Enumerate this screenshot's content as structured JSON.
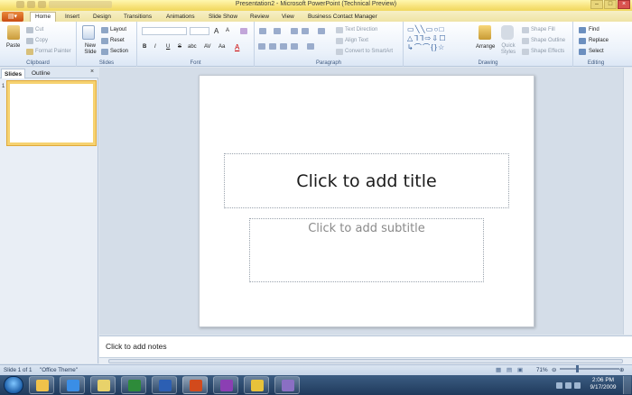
{
  "window": {
    "title": "Presentation2 - Microsoft PowerPoint (Technical Preview)",
    "controls": [
      "–",
      "□",
      "×"
    ]
  },
  "ribbon": {
    "tabs": [
      "Home",
      "Insert",
      "Design",
      "Transitions",
      "Animations",
      "Slide Show",
      "Review",
      "View",
      "Business Contact Manager"
    ],
    "active_tab": "Home",
    "clipboard": {
      "paste": "Paste",
      "cut": "Cut",
      "copy": "Copy",
      "format_painter": "Format Painter",
      "label": "Clipboard"
    },
    "slides": {
      "new_slide": "New Slide",
      "layout": "Layout",
      "reset": "Reset",
      "section": "Section",
      "label": "Slides"
    },
    "font": {
      "bold": "B",
      "italic": "I",
      "underline": "U",
      "strike": "S",
      "shadow": "abc",
      "spacing": "AV",
      "case": "Aa",
      "grow": "A",
      "shrink": "A",
      "color": "A",
      "label": "Font"
    },
    "paragraph": {
      "text_direction": "Text Direction",
      "align_text": "Align Text",
      "smartart": "Convert to SmartArt",
      "label": "Paragraph"
    },
    "drawing": {
      "arrange": "Arrange",
      "quick_styles": "Quick Styles",
      "shape_fill": "Shape Fill",
      "shape_outline": "Shape Outline",
      "shape_effects": "Shape Effects",
      "label": "Drawing"
    },
    "editing": {
      "find": "Find",
      "replace": "Replace",
      "select": "Select",
      "label": "Editing"
    }
  },
  "panel": {
    "tabs": [
      "Slides",
      "Outline"
    ],
    "close": "×",
    "slide_number": "1"
  },
  "slide": {
    "title_placeholder": "Click to add title",
    "subtitle_placeholder": "Click to add subtitle"
  },
  "notes": {
    "placeholder": "Click to add notes"
  },
  "status": {
    "slide_info": "Slide 1 of 1",
    "theme": "\"Office Theme\"",
    "zoom": "71%"
  },
  "taskbar": {
    "time": "2:06 PM",
    "date": "9/17/2009",
    "apps": [
      {
        "name": "folder",
        "color": "#f0c24a"
      },
      {
        "name": "ie",
        "color": "#3a8ee6"
      },
      {
        "name": "explorer",
        "color": "#e8d26a"
      },
      {
        "name": "excel",
        "color": "#2e8b3a"
      },
      {
        "name": "word",
        "color": "#2c5fb3"
      },
      {
        "name": "powerpoint",
        "color": "#d24a1c"
      },
      {
        "name": "onenote",
        "color": "#8b3fb3"
      },
      {
        "name": "outlook",
        "color": "#e7c23a"
      },
      {
        "name": "visio",
        "color": "#8a6fc3"
      }
    ]
  },
  "colors": {
    "accent": "#f6d271",
    "ribbon_bg": "#eaf1fa",
    "taskbar": "#1f3a5c"
  }
}
